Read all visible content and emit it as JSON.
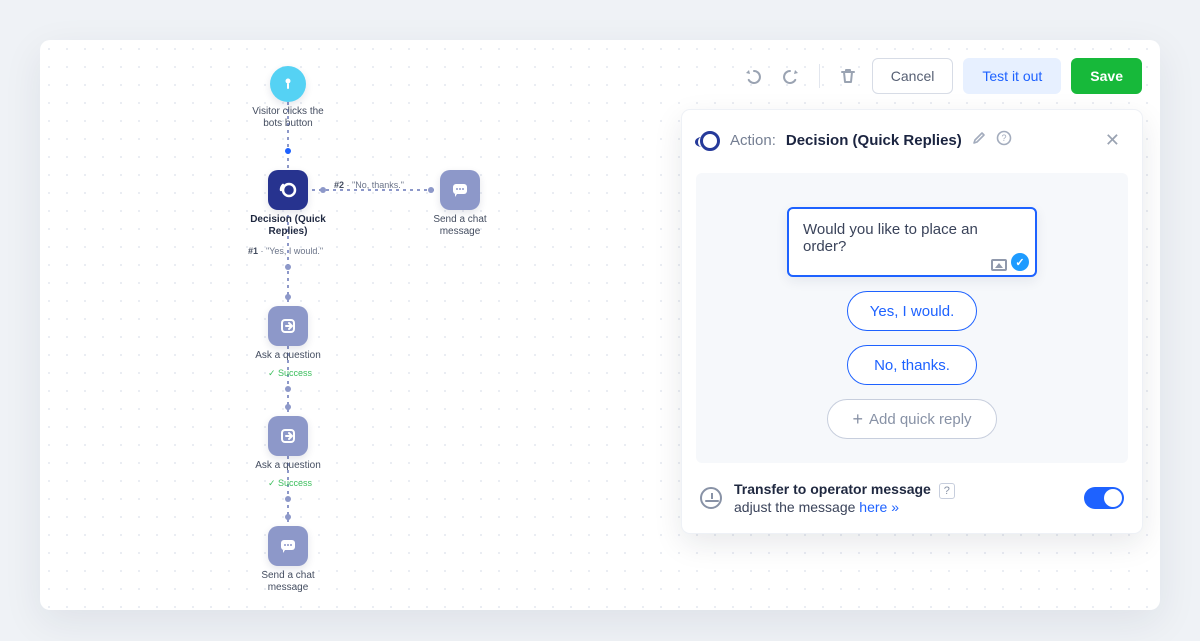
{
  "toolbar": {
    "cancel": "Cancel",
    "test": "Test it out",
    "save": "Save"
  },
  "panel": {
    "label": "Action:",
    "title": "Decision (Quick Replies)",
    "message": "Would you like to place an order?",
    "reply1": "Yes, I would.",
    "reply2": "No, thanks.",
    "add_reply": "Add quick reply",
    "footer_title": "Transfer to operator message",
    "footer_sub_prefix": "adjust the message ",
    "footer_link": "here »"
  },
  "flow": {
    "start": "Visitor clicks the bots button",
    "decision": "Decision (Quick Replies)",
    "branch1_tag": "#1",
    "branch1": "\"Yes, I would.\"",
    "branch2_tag": "#2",
    "branch2": "\"No, thanks.\"",
    "send_msg": "Send a chat message",
    "ask": "Ask a question",
    "success": "Success"
  }
}
